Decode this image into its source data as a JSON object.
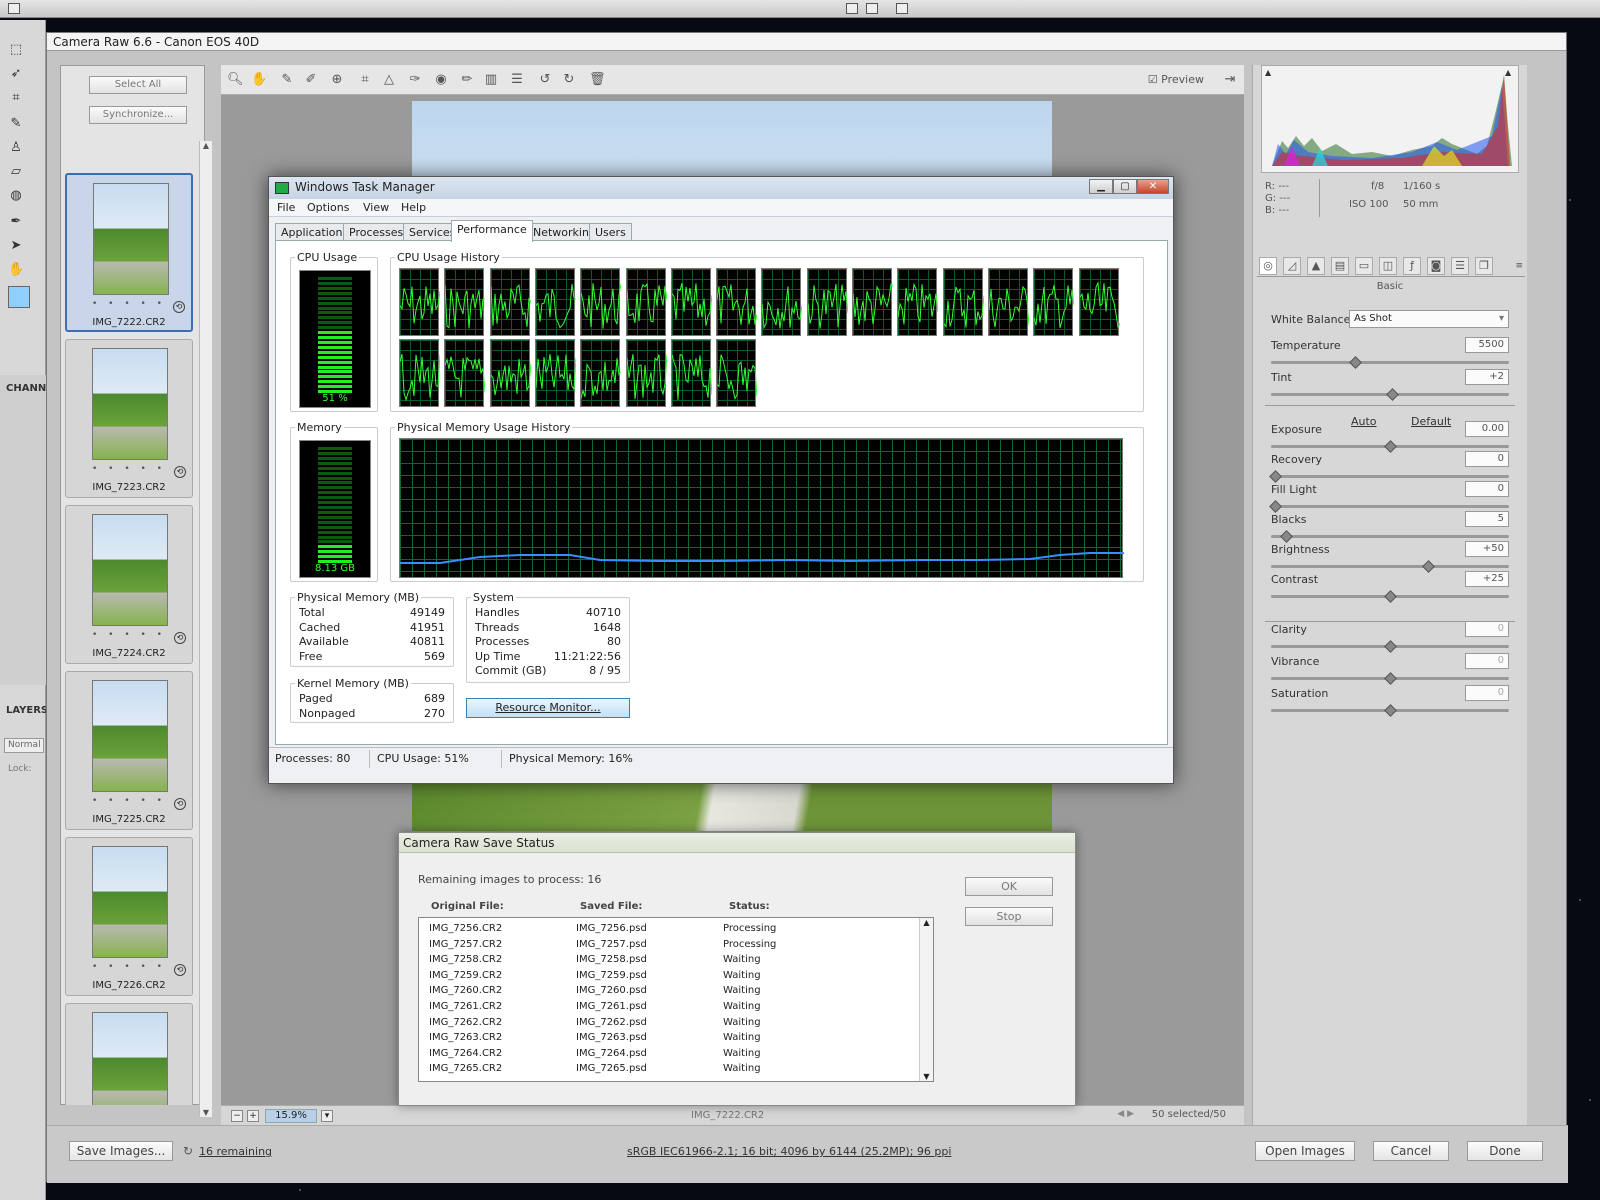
{
  "camera_raw": {
    "title": "Camera Raw 6.6  -  Canon EOS 40D",
    "select_all": "Select All",
    "synchronize": "Synchronize...",
    "thumbnails": [
      {
        "name": "IMG_7222.CR2",
        "selected": true
      },
      {
        "name": "IMG_7223.CR2"
      },
      {
        "name": "IMG_7224.CR2"
      },
      {
        "name": "IMG_7225.CR2"
      },
      {
        "name": "IMG_7226.CR2"
      },
      {
        "name": ""
      }
    ],
    "rating_dots": "• • • • •",
    "preview_label": "Preview",
    "zoom": "15.9%",
    "selected_count": "50 selected/50",
    "current_file": "IMG_7222.CR2",
    "histogram_info": {
      "r": "R:   ---",
      "g": "G:   ---",
      "b": "B:   ---",
      "aperture": "f/8",
      "shutter": "1/160 s",
      "iso": "ISO 100",
      "focal": "50 mm"
    },
    "panel_title": "Basic",
    "white_balance_label": "White Balance:",
    "white_balance_value": "As Shot",
    "auto_link": "Auto",
    "default_link": "Default",
    "controls": [
      {
        "label": "Temperature",
        "value": "5500",
        "level": 0.35
      },
      {
        "label": "Tint",
        "value": "+2",
        "level": 0.51
      },
      {
        "label": "Exposure",
        "value": "0.00",
        "level": 0.5
      },
      {
        "label": "Recovery",
        "value": "0",
        "level": 0.0
      },
      {
        "label": "Fill Light",
        "value": "0",
        "level": 0.0
      },
      {
        "label": "Blacks",
        "value": "5",
        "level": 0.05
      },
      {
        "label": "Brightness",
        "value": "+50",
        "level": 0.67
      },
      {
        "label": "Contrast",
        "value": "+25",
        "level": 0.5
      },
      {
        "label": "Clarity",
        "value": "0",
        "level": 0.5
      },
      {
        "label": "Vibrance",
        "value": "0",
        "level": 0.5
      },
      {
        "label": "Saturation",
        "value": "0",
        "level": 0.5
      }
    ],
    "save_images": "Save Images...",
    "remaining_link": "16 remaining",
    "workflow_link": "sRGB IEC61966-2.1; 16 bit; 4096 by 6144 (25.2MP); 96 ppi",
    "open_images": "Open Images",
    "cancel": "Cancel",
    "done": "Done"
  },
  "photoshop": {
    "channels_label": "CHANN",
    "layers_label": "LAYERS",
    "blend_mode": "Normal",
    "lock_label": "Lock:"
  },
  "task_manager": {
    "title": "Windows Task Manager",
    "menu": [
      "File",
      "Options",
      "View",
      "Help"
    ],
    "tabs": [
      "Applications",
      "Processes",
      "Services",
      "Performance",
      "Networking",
      "Users"
    ],
    "active_tab": "Performance",
    "cpu_usage_label": "CPU Usage",
    "cpu_usage_value": "51 %",
    "cpu_usage_level": 0.51,
    "cpu_history_label": "CPU Usage History",
    "cpu_core_count": 24,
    "memory_label": "Memory",
    "memory_value": "8.13 GB",
    "memory_level": 0.16,
    "mem_history_label": "Physical Memory Usage History",
    "physical_memory": {
      "label": "Physical Memory (MB)",
      "rows": [
        {
          "k": "Total",
          "v": "49149"
        },
        {
          "k": "Cached",
          "v": "41951"
        },
        {
          "k": "Available",
          "v": "40811"
        },
        {
          "k": "Free",
          "v": "569"
        }
      ]
    },
    "kernel_memory": {
      "label": "Kernel Memory (MB)",
      "rows": [
        {
          "k": "Paged",
          "v": "689"
        },
        {
          "k": "Nonpaged",
          "v": "270"
        }
      ]
    },
    "system": {
      "label": "System",
      "rows": [
        {
          "k": "Handles",
          "v": "40710"
        },
        {
          "k": "Threads",
          "v": "1648"
        },
        {
          "k": "Processes",
          "v": "80"
        },
        {
          "k": "Up Time",
          "v": "11:21:22:56"
        },
        {
          "k": "Commit (GB)",
          "v": "8 / 95"
        }
      ]
    },
    "resource_monitor": "Resource Monitor...",
    "status": {
      "processes": "Processes: 80",
      "cpu": "CPU Usage: 51%",
      "memory": "Physical Memory: 16%"
    }
  },
  "save_status": {
    "title": "Camera Raw Save Status",
    "remaining": "Remaining images to process:  16",
    "ok": "OK",
    "stop": "Stop",
    "headers": [
      "Original File:",
      "Saved File:",
      "Status:"
    ],
    "rows": [
      [
        "IMG_7256.CR2",
        "IMG_7256.psd",
        "Processing"
      ],
      [
        "IMG_7257.CR2",
        "IMG_7257.psd",
        "Processing"
      ],
      [
        "IMG_7258.CR2",
        "IMG_7258.psd",
        "Waiting"
      ],
      [
        "IMG_7259.CR2",
        "IMG_7259.psd",
        "Waiting"
      ],
      [
        "IMG_7260.CR2",
        "IMG_7260.psd",
        "Waiting"
      ],
      [
        "IMG_7261.CR2",
        "IMG_7261.psd",
        "Waiting"
      ],
      [
        "IMG_7262.CR2",
        "IMG_7262.psd",
        "Waiting"
      ],
      [
        "IMG_7263.CR2",
        "IMG_7263.psd",
        "Waiting"
      ],
      [
        "IMG_7264.CR2",
        "IMG_7264.psd",
        "Waiting"
      ],
      [
        "IMG_7265.CR2",
        "IMG_7265.psd",
        "Waiting"
      ]
    ]
  }
}
